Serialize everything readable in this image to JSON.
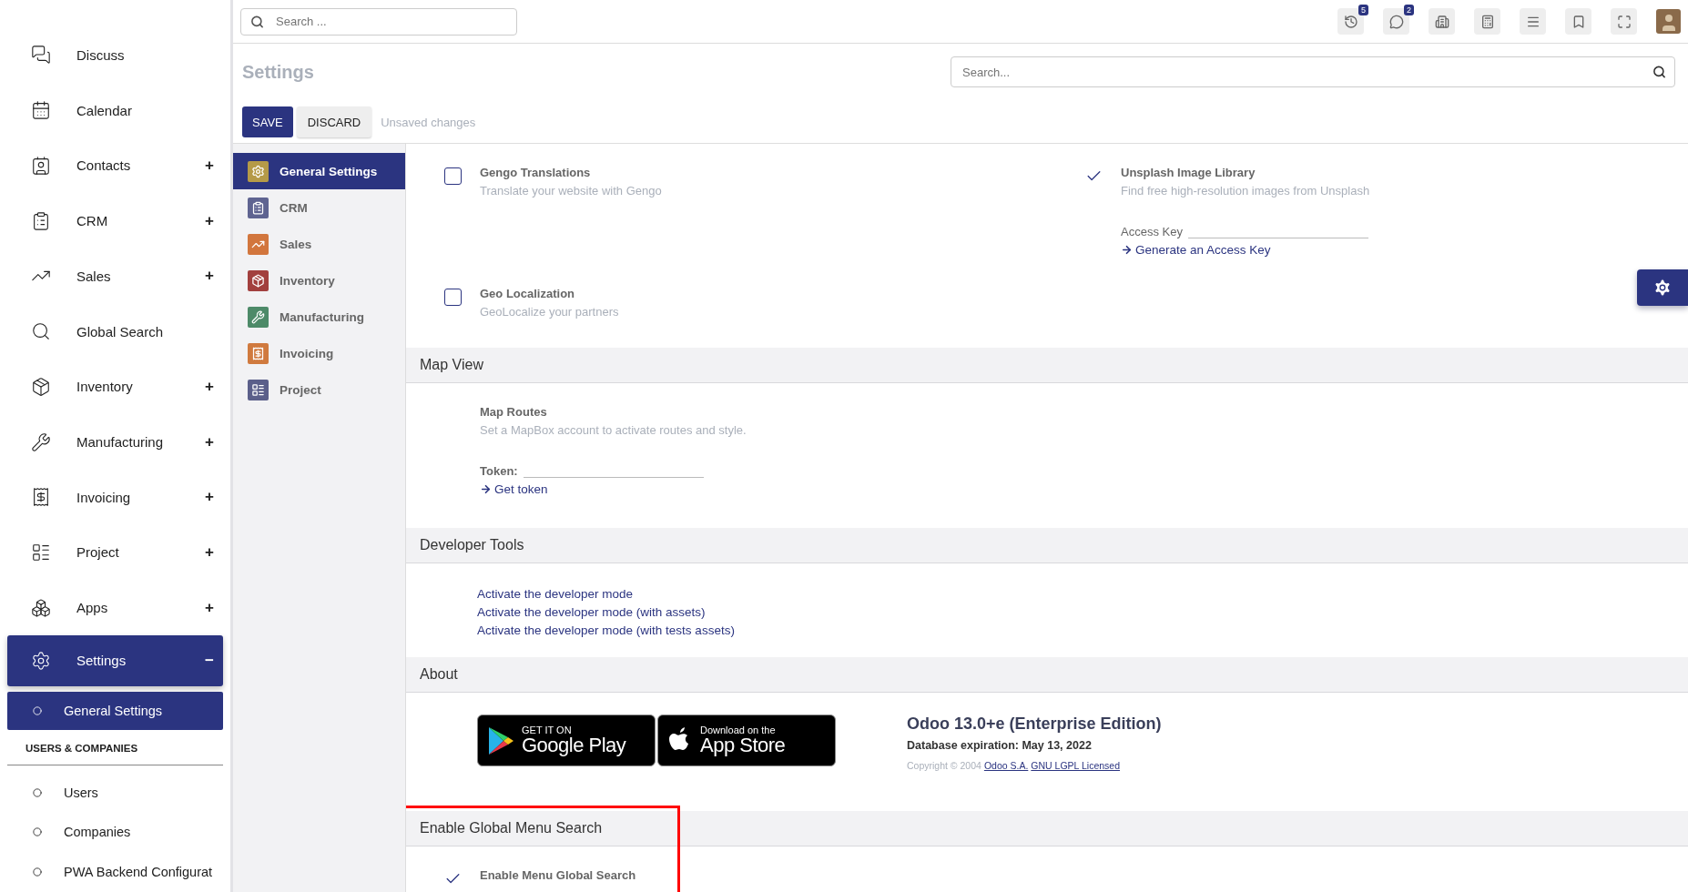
{
  "topbar": {
    "search_placeholder": "Search ...",
    "icons": [
      {
        "kind": "history",
        "badge": "5"
      },
      {
        "kind": "chat",
        "badge": "2"
      },
      {
        "kind": "building"
      },
      {
        "kind": "calculator"
      },
      {
        "kind": "menu"
      },
      {
        "kind": "bookmark"
      },
      {
        "kind": "fullscreen"
      },
      {
        "kind": "avatar"
      }
    ]
  },
  "sidebar": {
    "items": [
      {
        "label": "Discuss",
        "selected": false
      },
      {
        "label": "Calendar",
        "selected": false
      },
      {
        "label": "Contacts",
        "toggle": "+",
        "selected": false
      },
      {
        "label": "CRM",
        "toggle": "+",
        "selected": false
      },
      {
        "label": "Sales",
        "toggle": "+",
        "selected": false
      },
      {
        "label": "Global Search",
        "selected": false
      },
      {
        "label": "Inventory",
        "toggle": "+",
        "selected": false
      },
      {
        "label": "Manufacturing",
        "toggle": "+",
        "selected": false
      },
      {
        "label": "Invoicing",
        "toggle": "+",
        "selected": false
      },
      {
        "label": "Project",
        "toggle": "+",
        "selected": false
      },
      {
        "label": "Apps",
        "toggle": "+",
        "selected": false
      },
      {
        "label": "Settings",
        "toggle": "−",
        "selected": true
      }
    ],
    "subitems": [
      {
        "label": "General Settings",
        "selected": true
      }
    ],
    "group_title": "USERS & COMPANIES",
    "group_items": [
      {
        "label": "Users",
        "selected": false
      },
      {
        "label": "Companies",
        "selected": false
      },
      {
        "label": "PWA Backend Configurat",
        "selected": false
      }
    ]
  },
  "control_panel": {
    "title": "Settings",
    "search_placeholder": "Search...",
    "save": "SAVE",
    "discard": "DISCARD",
    "status": "Unsaved changes"
  },
  "app_nav": [
    {
      "label": "General Settings",
      "color": "#b59a48",
      "selected": true
    },
    {
      "label": "CRM",
      "color": "#5f6491",
      "selected": false
    },
    {
      "label": "Sales",
      "color": "#d2763d",
      "selected": false
    },
    {
      "label": "Inventory",
      "color": "#a2403e",
      "selected": false
    },
    {
      "label": "Manufacturing",
      "color": "#4d8a68",
      "selected": false
    },
    {
      "label": "Invoicing",
      "color": "#d07a3e",
      "selected": false
    },
    {
      "label": "Project",
      "color": "#5b5f8a",
      "selected": false
    }
  ],
  "sections": [
    {
      "kind": "options",
      "options": [
        {
          "kind": "checkbox",
          "checked": false,
          "title": "Gengo Translations",
          "description": "Translate your website with Gengo"
        },
        {
          "kind": "checkbox",
          "checked": true,
          "title": "Unsplash Image Library",
          "description": "Find free high-resolution images from Unsplash",
          "field_label": "Access Key",
          "link": "Generate an Access Key"
        },
        {
          "kind": "checkbox",
          "checked": false,
          "title": "Geo Localization",
          "description": "GeoLocalize your partners"
        }
      ]
    },
    {
      "kind": "options",
      "title": "Map View",
      "options": [
        {
          "kind": "plain",
          "title": "Map Routes",
          "description": "Set a MapBox account to activate routes and style.",
          "field_label": "Token:",
          "link": "Get token"
        }
      ]
    },
    {
      "kind": "links",
      "title": "Developer Tools",
      "links": [
        "Activate the developer mode",
        "Activate the developer mode (with assets)",
        "Activate the developer mode (with tests assets)"
      ]
    },
    {
      "kind": "about",
      "title": "About",
      "badges": [
        {
          "kind": "google",
          "small": "GET IT ON",
          "big": "Google Play"
        },
        {
          "kind": "apple",
          "small": "Download on the",
          "big": "App Store"
        }
      ],
      "edition": "Odoo 13.0+e (Enterprise Edition)",
      "expiration": "Database expiration: May 13, 2022",
      "copyright": "Copyright © 2004",
      "copyright_links": [
        "Odoo S.A.",
        "GNU LGPL Licensed"
      ]
    },
    {
      "kind": "options",
      "title": "Enable Global Menu Search",
      "annotated": true,
      "options": [
        {
          "kind": "checkbox",
          "checked": true,
          "title": "Enable Menu Global Search"
        }
      ]
    }
  ]
}
